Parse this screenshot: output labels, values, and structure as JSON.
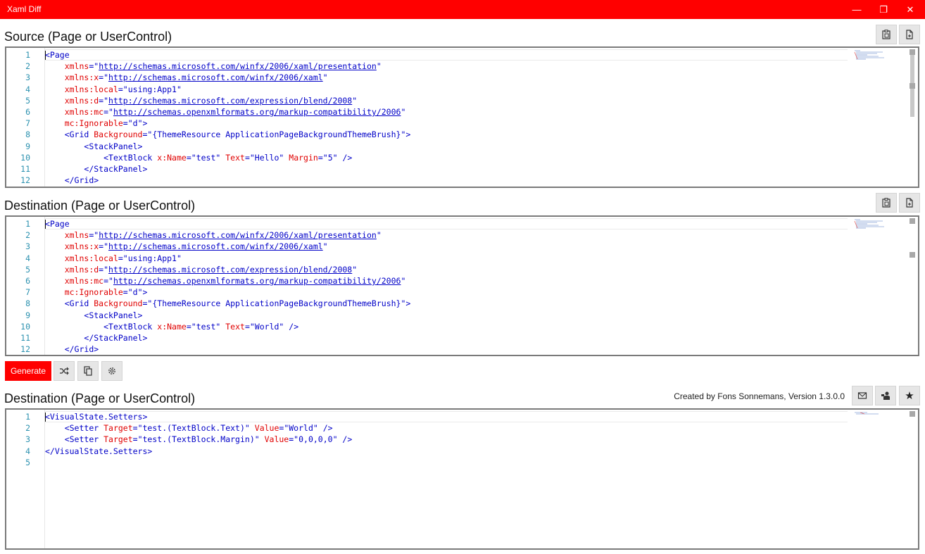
{
  "window": {
    "title": "Xaml Diff"
  },
  "source": {
    "label": "Source (Page or UserControl)",
    "lines": [
      [
        "1",
        "<",
        "Page",
        "",
        "",
        ""
      ],
      [
        "2"
      ],
      [
        "3"
      ],
      [
        "4"
      ],
      [
        "5"
      ],
      [
        "6"
      ],
      [
        "7"
      ],
      [
        "8"
      ],
      [
        "9"
      ],
      [
        "10"
      ],
      [
        "11"
      ],
      [
        "12"
      ]
    ]
  },
  "destination": {
    "label": "Destination (Page or UserControl)"
  },
  "output": {
    "label": "Destination (Page or UserControl)"
  },
  "toolbar": {
    "generate_label": "Generate"
  },
  "credit": "Created by Fons Sonnemans, Version 1.3.0.0",
  "editors": {
    "source_lines": [
      {
        "n": "1",
        "segs": [
          [
            "caret",
            ""
          ],
          [
            "tag",
            "<Page"
          ]
        ]
      },
      {
        "n": "2",
        "segs": [
          [
            "sp",
            "    "
          ],
          [
            "attr",
            "xmlns"
          ],
          [
            "sep",
            "=\""
          ],
          [
            "url",
            "http://schemas.microsoft.com/winfx/2006/xaml/presentation"
          ],
          [
            "sep",
            "\""
          ]
        ]
      },
      {
        "n": "3",
        "segs": [
          [
            "sp",
            "    "
          ],
          [
            "attr",
            "xmlns:x"
          ],
          [
            "sep",
            "=\""
          ],
          [
            "url",
            "http://schemas.microsoft.com/winfx/2006/xaml"
          ],
          [
            "sep",
            "\""
          ]
        ]
      },
      {
        "n": "4",
        "segs": [
          [
            "sp",
            "    "
          ],
          [
            "attr",
            "xmlns:local"
          ],
          [
            "sep",
            "=\""
          ],
          [
            "val",
            "using:App1"
          ],
          [
            "sep",
            "\""
          ]
        ]
      },
      {
        "n": "5",
        "segs": [
          [
            "sp",
            "    "
          ],
          [
            "attr",
            "xmlns:d"
          ],
          [
            "sep",
            "=\""
          ],
          [
            "url",
            "http://schemas.microsoft.com/expression/blend/2008"
          ],
          [
            "sep",
            "\""
          ]
        ]
      },
      {
        "n": "6",
        "segs": [
          [
            "sp",
            "    "
          ],
          [
            "attr",
            "xmlns:mc"
          ],
          [
            "sep",
            "=\""
          ],
          [
            "url",
            "http://schemas.openxmlformats.org/markup-compatibility/2006"
          ],
          [
            "sep",
            "\""
          ]
        ]
      },
      {
        "n": "7",
        "segs": [
          [
            "sp",
            "    "
          ],
          [
            "attr",
            "mc:Ignorable"
          ],
          [
            "sep",
            "=\""
          ],
          [
            "val",
            "d"
          ],
          [
            "sep",
            "\""
          ],
          [
            "tag",
            ">"
          ]
        ]
      },
      {
        "n": "8",
        "segs": [
          [
            "sp",
            "    "
          ],
          [
            "tag",
            "<Grid "
          ],
          [
            "attr",
            "Background"
          ],
          [
            "sep",
            "=\""
          ],
          [
            "val",
            "{ThemeResource ApplicationPageBackgroundThemeBrush}"
          ],
          [
            "sep",
            "\""
          ],
          [
            "tag",
            ">"
          ]
        ]
      },
      {
        "n": "9",
        "segs": [
          [
            "sp",
            "        "
          ],
          [
            "tag",
            "<StackPanel>"
          ]
        ]
      },
      {
        "n": "10",
        "segs": [
          [
            "sp",
            "            "
          ],
          [
            "tag",
            "<TextBlock "
          ],
          [
            "attr",
            "x:Name"
          ],
          [
            "sep",
            "=\""
          ],
          [
            "val",
            "test"
          ],
          [
            "sep",
            "\" "
          ],
          [
            "attr",
            "Text"
          ],
          [
            "sep",
            "=\""
          ],
          [
            "val",
            "Hello"
          ],
          [
            "sep",
            "\" "
          ],
          [
            "attr",
            "Margin"
          ],
          [
            "sep",
            "=\""
          ],
          [
            "val",
            "5"
          ],
          [
            "sep",
            "\" "
          ],
          [
            "tag",
            "/>"
          ]
        ]
      },
      {
        "n": "11",
        "segs": [
          [
            "sp",
            "        "
          ],
          [
            "tag",
            "</StackPanel>"
          ]
        ]
      },
      {
        "n": "12",
        "segs": [
          [
            "sp",
            "    "
          ],
          [
            "tag",
            "</Grid>"
          ]
        ]
      }
    ],
    "dest_lines": [
      {
        "n": "1",
        "segs": [
          [
            "caret",
            ""
          ],
          [
            "tag",
            "<Page"
          ]
        ]
      },
      {
        "n": "2",
        "segs": [
          [
            "sp",
            "    "
          ],
          [
            "attr",
            "xmlns"
          ],
          [
            "sep",
            "=\""
          ],
          [
            "url",
            "http://schemas.microsoft.com/winfx/2006/xaml/presentation"
          ],
          [
            "sep",
            "\""
          ]
        ]
      },
      {
        "n": "3",
        "segs": [
          [
            "sp",
            "    "
          ],
          [
            "attr",
            "xmlns:x"
          ],
          [
            "sep",
            "=\""
          ],
          [
            "url",
            "http://schemas.microsoft.com/winfx/2006/xaml"
          ],
          [
            "sep",
            "\""
          ]
        ]
      },
      {
        "n": "4",
        "segs": [
          [
            "sp",
            "    "
          ],
          [
            "attr",
            "xmlns:local"
          ],
          [
            "sep",
            "=\""
          ],
          [
            "val",
            "using:App1"
          ],
          [
            "sep",
            "\""
          ]
        ]
      },
      {
        "n": "5",
        "segs": [
          [
            "sp",
            "    "
          ],
          [
            "attr",
            "xmlns:d"
          ],
          [
            "sep",
            "=\""
          ],
          [
            "url",
            "http://schemas.microsoft.com/expression/blend/2008"
          ],
          [
            "sep",
            "\""
          ]
        ]
      },
      {
        "n": "6",
        "segs": [
          [
            "sp",
            "    "
          ],
          [
            "attr",
            "xmlns:mc"
          ],
          [
            "sep",
            "=\""
          ],
          [
            "url",
            "http://schemas.openxmlformats.org/markup-compatibility/2006"
          ],
          [
            "sep",
            "\""
          ]
        ]
      },
      {
        "n": "7",
        "segs": [
          [
            "sp",
            "    "
          ],
          [
            "attr",
            "mc:Ignorable"
          ],
          [
            "sep",
            "=\""
          ],
          [
            "val",
            "d"
          ],
          [
            "sep",
            "\""
          ],
          [
            "tag",
            ">"
          ]
        ]
      },
      {
        "n": "8",
        "segs": [
          [
            "sp",
            "    "
          ],
          [
            "tag",
            "<Grid "
          ],
          [
            "attr",
            "Background"
          ],
          [
            "sep",
            "=\""
          ],
          [
            "val",
            "{ThemeResource ApplicationPageBackgroundThemeBrush}"
          ],
          [
            "sep",
            "\""
          ],
          [
            "tag",
            ">"
          ]
        ]
      },
      {
        "n": "9",
        "segs": [
          [
            "sp",
            "        "
          ],
          [
            "tag",
            "<StackPanel>"
          ]
        ]
      },
      {
        "n": "10",
        "segs": [
          [
            "sp",
            "            "
          ],
          [
            "tag",
            "<TextBlock "
          ],
          [
            "attr",
            "x:Name"
          ],
          [
            "sep",
            "=\""
          ],
          [
            "val",
            "test"
          ],
          [
            "sep",
            "\" "
          ],
          [
            "attr",
            "Text"
          ],
          [
            "sep",
            "=\""
          ],
          [
            "val",
            "World"
          ],
          [
            "sep",
            "\" "
          ],
          [
            "tag",
            "/>"
          ]
        ]
      },
      {
        "n": "11",
        "segs": [
          [
            "sp",
            "        "
          ],
          [
            "tag",
            "</StackPanel>"
          ]
        ]
      },
      {
        "n": "12",
        "segs": [
          [
            "sp",
            "    "
          ],
          [
            "tag",
            "</Grid>"
          ]
        ]
      }
    ],
    "output_lines": [
      {
        "n": "1",
        "segs": [
          [
            "caret",
            ""
          ],
          [
            "tag",
            "<VisualState.Setters>"
          ]
        ]
      },
      {
        "n": "2",
        "segs": [
          [
            "sp",
            "    "
          ],
          [
            "tag",
            "<Setter "
          ],
          [
            "attr",
            "Target"
          ],
          [
            "sep",
            "=\""
          ],
          [
            "val",
            "test.(TextBlock.Text)"
          ],
          [
            "sep",
            "\" "
          ],
          [
            "attr",
            "Value"
          ],
          [
            "sep",
            "=\""
          ],
          [
            "val",
            "World"
          ],
          [
            "sep",
            "\" "
          ],
          [
            "tag",
            "/>"
          ]
        ]
      },
      {
        "n": "3",
        "segs": [
          [
            "sp",
            "    "
          ],
          [
            "tag",
            "<Setter "
          ],
          [
            "attr",
            "Target"
          ],
          [
            "sep",
            "=\""
          ],
          [
            "val",
            "test.(TextBlock.Margin)"
          ],
          [
            "sep",
            "\" "
          ],
          [
            "attr",
            "Value"
          ],
          [
            "sep",
            "=\""
          ],
          [
            "val",
            "0,0,0,0"
          ],
          [
            "sep",
            "\" "
          ],
          [
            "tag",
            "/>"
          ]
        ]
      },
      {
        "n": "4",
        "segs": [
          [
            "tag",
            "</VisualState.Setters>"
          ]
        ]
      },
      {
        "n": "5",
        "segs": []
      }
    ]
  },
  "icons": {
    "paste": "clipboard-icon",
    "open": "open-file-icon",
    "swap": "shuffle-icon",
    "copy": "copy-icon",
    "settings": "gear-icon",
    "mail": "mail-icon",
    "feedback": "feedback-icon",
    "rate": "star-icon"
  },
  "colors": {
    "accent": "#ff0000"
  }
}
